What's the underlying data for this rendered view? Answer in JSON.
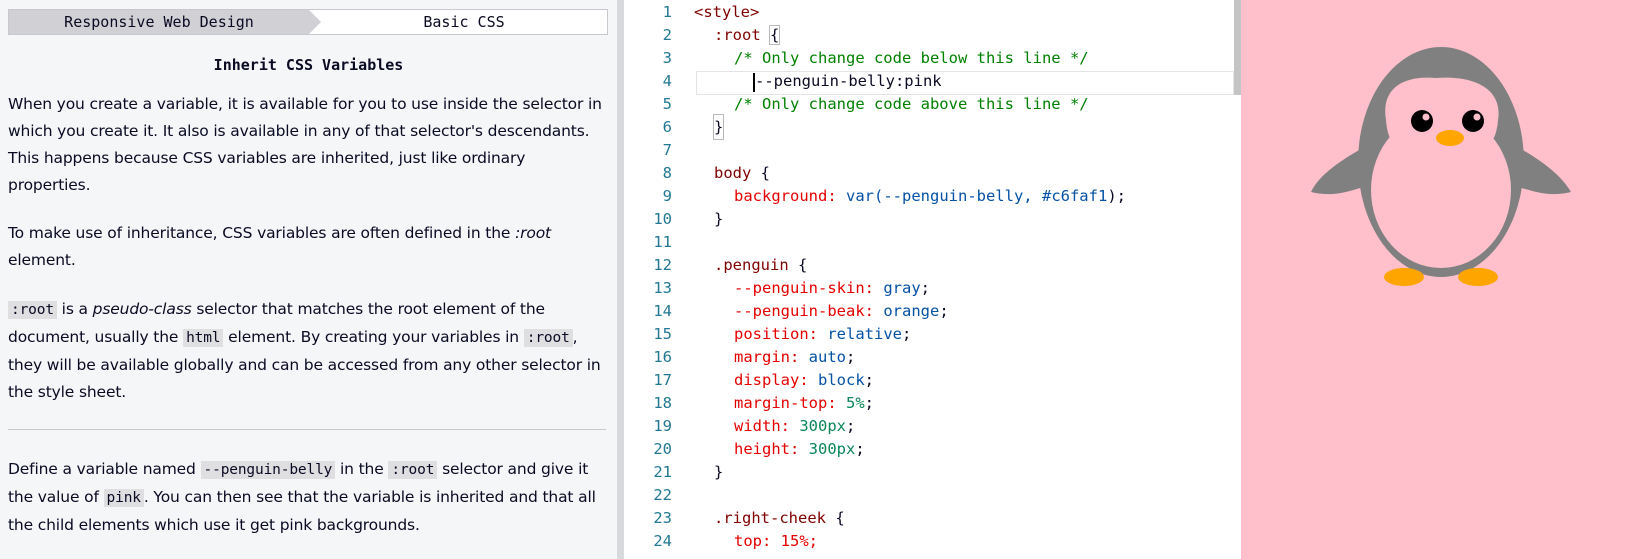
{
  "breadcrumb": {
    "section": "Responsive Web Design",
    "module": "Basic CSS"
  },
  "challenge_title": "Inherit CSS Variables",
  "description": {
    "p1": "When you create a variable, it is available for you to use inside the selector in which you create it. It also is available in any of that selector's descendants. This happens because CSS variables are inherited, just like ordinary properties.",
    "p2_before": "To make use of inheritance, CSS variables are often defined in the ",
    "p2_em": ":root",
    "p2_after": " element.",
    "p3_code1": ":root",
    "p3_t1": " is a ",
    "p3_em": "pseudo-class",
    "p3_t2": " selector that matches the root element of the document, usually the ",
    "p3_code2": "html",
    "p3_t3": " element. By creating your variables in ",
    "p3_code3": ":root",
    "p3_t4": ", they will be available globally and can be accessed from any other selector in the style sheet.",
    "p4_t1": "Define a variable named ",
    "p4_code1": "--penguin-belly",
    "p4_t2": " in the ",
    "p4_code2": ":root",
    "p4_t3": " selector and give it the value of ",
    "p4_code3": "pink",
    "p4_t4": ". You can then see that the variable is inherited and that all the child elements which use it get pink backgrounds."
  },
  "editor": {
    "line_numbers": [
      "1",
      "2",
      "3",
      "4",
      "5",
      "6",
      "7",
      "8",
      "9",
      "10",
      "11",
      "12",
      "13",
      "14",
      "15",
      "16",
      "17",
      "18",
      "19",
      "20",
      "21",
      "22",
      "23",
      "24"
    ],
    "l1": "<style>",
    "l2_sel": ":root ",
    "l2_brace": "{",
    "l3": "/* Only change code below this line */",
    "l4": "--penguin-belly:pink",
    "l5": "/* Only change code above this line */",
    "l6": "}",
    "l8_sel": "body",
    "l8_rest": " {",
    "l9_prop": "background:",
    "l9_fn": "var(--penguin-belly,",
    "l9_hex": "#c6faf1",
    "l9_end": ");",
    "l10": "}",
    "l12_sel": ".penguin",
    "l12_rest": " {",
    "l13_prop": "--penguin-skin:",
    "l13_val": "gray",
    "l14_prop": "--penguin-beak:",
    "l14_val": "orange",
    "l15_prop": "position:",
    "l15_val": "relative",
    "l16_prop": "margin:",
    "l16_val": "auto",
    "l17_prop": "display:",
    "l17_val": "block",
    "l18_prop": "margin-top:",
    "l18_val": "5%",
    "l19_prop": "width:",
    "l19_val": "300px",
    "l20_prop": "height:",
    "l20_val": "300px",
    "l21": "}",
    "l23_sel": ".right-cheek",
    "l23_rest": " {",
    "l24_partial": "top: 15%;"
  },
  "preview": {
    "background": "#ffc0cb",
    "skin": "#808080",
    "belly": "#ffc0cb",
    "beak": "#ffa500",
    "eye": "#000000"
  }
}
